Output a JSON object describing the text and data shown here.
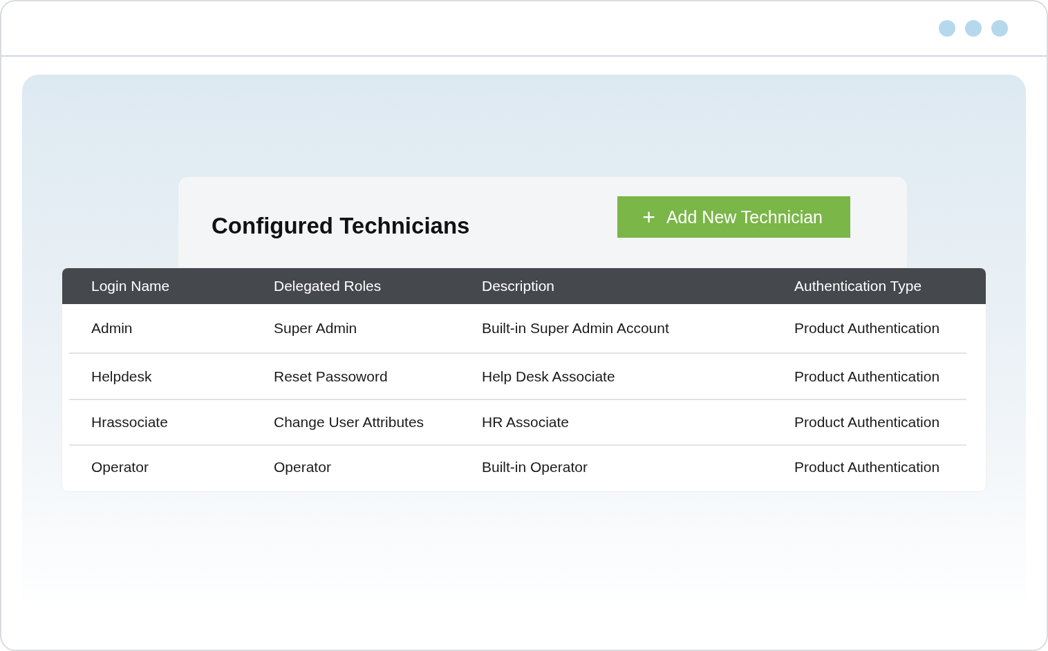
{
  "title": "Configured Technicians",
  "add_button": {
    "icon": "+",
    "label": "Add New Technician"
  },
  "table": {
    "columns": [
      "Login Name",
      "Delegated Roles",
      "Description",
      "Authentication Type"
    ],
    "rows": [
      [
        "Admin",
        "Super Admin",
        "Built-in Super Admin Account",
        "Product Authentication"
      ],
      [
        "Helpdesk",
        "Reset Passoword",
        "Help Desk Associate",
        "Product Authentication"
      ],
      [
        "Hrassociate",
        "Change User Attributes",
        "HR Associate",
        "Product Authentication"
      ],
      [
        "Operator",
        "Operator",
        "Built-in Operator",
        "Product Authentication"
      ]
    ]
  }
}
